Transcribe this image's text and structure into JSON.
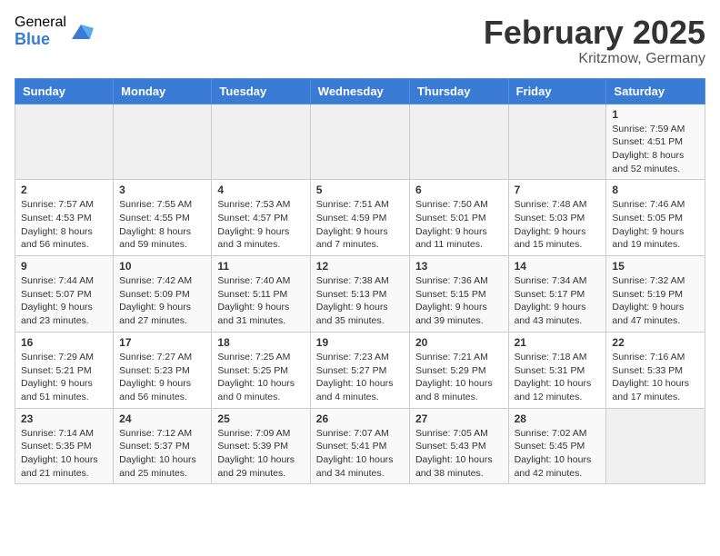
{
  "header": {
    "logo_general": "General",
    "logo_blue": "Blue",
    "title": "February 2025",
    "location": "Kritzmow, Germany"
  },
  "calendar": {
    "days_of_week": [
      "Sunday",
      "Monday",
      "Tuesday",
      "Wednesday",
      "Thursday",
      "Friday",
      "Saturday"
    ],
    "weeks": [
      [
        {
          "day": "",
          "info": ""
        },
        {
          "day": "",
          "info": ""
        },
        {
          "day": "",
          "info": ""
        },
        {
          "day": "",
          "info": ""
        },
        {
          "day": "",
          "info": ""
        },
        {
          "day": "",
          "info": ""
        },
        {
          "day": "1",
          "info": "Sunrise: 7:59 AM\nSunset: 4:51 PM\nDaylight: 8 hours\nand 52 minutes."
        }
      ],
      [
        {
          "day": "2",
          "info": "Sunrise: 7:57 AM\nSunset: 4:53 PM\nDaylight: 8 hours\nand 56 minutes."
        },
        {
          "day": "3",
          "info": "Sunrise: 7:55 AM\nSunset: 4:55 PM\nDaylight: 8 hours\nand 59 minutes."
        },
        {
          "day": "4",
          "info": "Sunrise: 7:53 AM\nSunset: 4:57 PM\nDaylight: 9 hours\nand 3 minutes."
        },
        {
          "day": "5",
          "info": "Sunrise: 7:51 AM\nSunset: 4:59 PM\nDaylight: 9 hours\nand 7 minutes."
        },
        {
          "day": "6",
          "info": "Sunrise: 7:50 AM\nSunset: 5:01 PM\nDaylight: 9 hours\nand 11 minutes."
        },
        {
          "day": "7",
          "info": "Sunrise: 7:48 AM\nSunset: 5:03 PM\nDaylight: 9 hours\nand 15 minutes."
        },
        {
          "day": "8",
          "info": "Sunrise: 7:46 AM\nSunset: 5:05 PM\nDaylight: 9 hours\nand 19 minutes."
        }
      ],
      [
        {
          "day": "9",
          "info": "Sunrise: 7:44 AM\nSunset: 5:07 PM\nDaylight: 9 hours\nand 23 minutes."
        },
        {
          "day": "10",
          "info": "Sunrise: 7:42 AM\nSunset: 5:09 PM\nDaylight: 9 hours\nand 27 minutes."
        },
        {
          "day": "11",
          "info": "Sunrise: 7:40 AM\nSunset: 5:11 PM\nDaylight: 9 hours\nand 31 minutes."
        },
        {
          "day": "12",
          "info": "Sunrise: 7:38 AM\nSunset: 5:13 PM\nDaylight: 9 hours\nand 35 minutes."
        },
        {
          "day": "13",
          "info": "Sunrise: 7:36 AM\nSunset: 5:15 PM\nDaylight: 9 hours\nand 39 minutes."
        },
        {
          "day": "14",
          "info": "Sunrise: 7:34 AM\nSunset: 5:17 PM\nDaylight: 9 hours\nand 43 minutes."
        },
        {
          "day": "15",
          "info": "Sunrise: 7:32 AM\nSunset: 5:19 PM\nDaylight: 9 hours\nand 47 minutes."
        }
      ],
      [
        {
          "day": "16",
          "info": "Sunrise: 7:29 AM\nSunset: 5:21 PM\nDaylight: 9 hours\nand 51 minutes."
        },
        {
          "day": "17",
          "info": "Sunrise: 7:27 AM\nSunset: 5:23 PM\nDaylight: 9 hours\nand 56 minutes."
        },
        {
          "day": "18",
          "info": "Sunrise: 7:25 AM\nSunset: 5:25 PM\nDaylight: 10 hours\nand 0 minutes."
        },
        {
          "day": "19",
          "info": "Sunrise: 7:23 AM\nSunset: 5:27 PM\nDaylight: 10 hours\nand 4 minutes."
        },
        {
          "day": "20",
          "info": "Sunrise: 7:21 AM\nSunset: 5:29 PM\nDaylight: 10 hours\nand 8 minutes."
        },
        {
          "day": "21",
          "info": "Sunrise: 7:18 AM\nSunset: 5:31 PM\nDaylight: 10 hours\nand 12 minutes."
        },
        {
          "day": "22",
          "info": "Sunrise: 7:16 AM\nSunset: 5:33 PM\nDaylight: 10 hours\nand 17 minutes."
        }
      ],
      [
        {
          "day": "23",
          "info": "Sunrise: 7:14 AM\nSunset: 5:35 PM\nDaylight: 10 hours\nand 21 minutes."
        },
        {
          "day": "24",
          "info": "Sunrise: 7:12 AM\nSunset: 5:37 PM\nDaylight: 10 hours\nand 25 minutes."
        },
        {
          "day": "25",
          "info": "Sunrise: 7:09 AM\nSunset: 5:39 PM\nDaylight: 10 hours\nand 29 minutes."
        },
        {
          "day": "26",
          "info": "Sunrise: 7:07 AM\nSunset: 5:41 PM\nDaylight: 10 hours\nand 34 minutes."
        },
        {
          "day": "27",
          "info": "Sunrise: 7:05 AM\nSunset: 5:43 PM\nDaylight: 10 hours\nand 38 minutes."
        },
        {
          "day": "28",
          "info": "Sunrise: 7:02 AM\nSunset: 5:45 PM\nDaylight: 10 hours\nand 42 minutes."
        },
        {
          "day": "",
          "info": ""
        }
      ]
    ]
  }
}
